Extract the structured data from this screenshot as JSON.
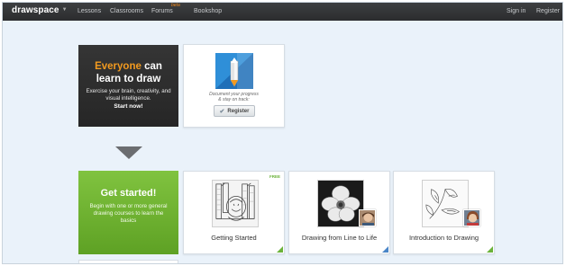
{
  "nav": {
    "logo": "drawspace",
    "items": [
      "Lessons",
      "Classrooms",
      "Forums",
      "Bookshop"
    ],
    "badge": "beta",
    "right": [
      "Sign in",
      "Register"
    ]
  },
  "hero": {
    "title_highlight": "Everyone",
    "title_rest": "can",
    "title_line2": "learn to draw",
    "body": "Exercise your brain, creativity, and visual intelligence.",
    "cta": "Start now!"
  },
  "register_card": {
    "tagline_line1": "Document your progress",
    "tagline_line2": "& stay on track:",
    "button": "Register",
    "icon": "pencil-app-icon"
  },
  "start": {
    "title": "Get started!",
    "body": "Begin with one or more general drawing courses to learn the basics"
  },
  "courses": [
    {
      "label": "Getting Started",
      "badge": "FREE",
      "corner": "green"
    },
    {
      "label": "Drawing from Line to Life",
      "corner": "blue"
    },
    {
      "label": "Introduction to Drawing",
      "corner": "green"
    }
  ],
  "colors": {
    "nav_bg": "#2b2c2e",
    "accent_orange": "#f29a1f",
    "green": "#6bb33a",
    "blue": "#4a86c8",
    "page_bg": "#eaf2fa"
  }
}
